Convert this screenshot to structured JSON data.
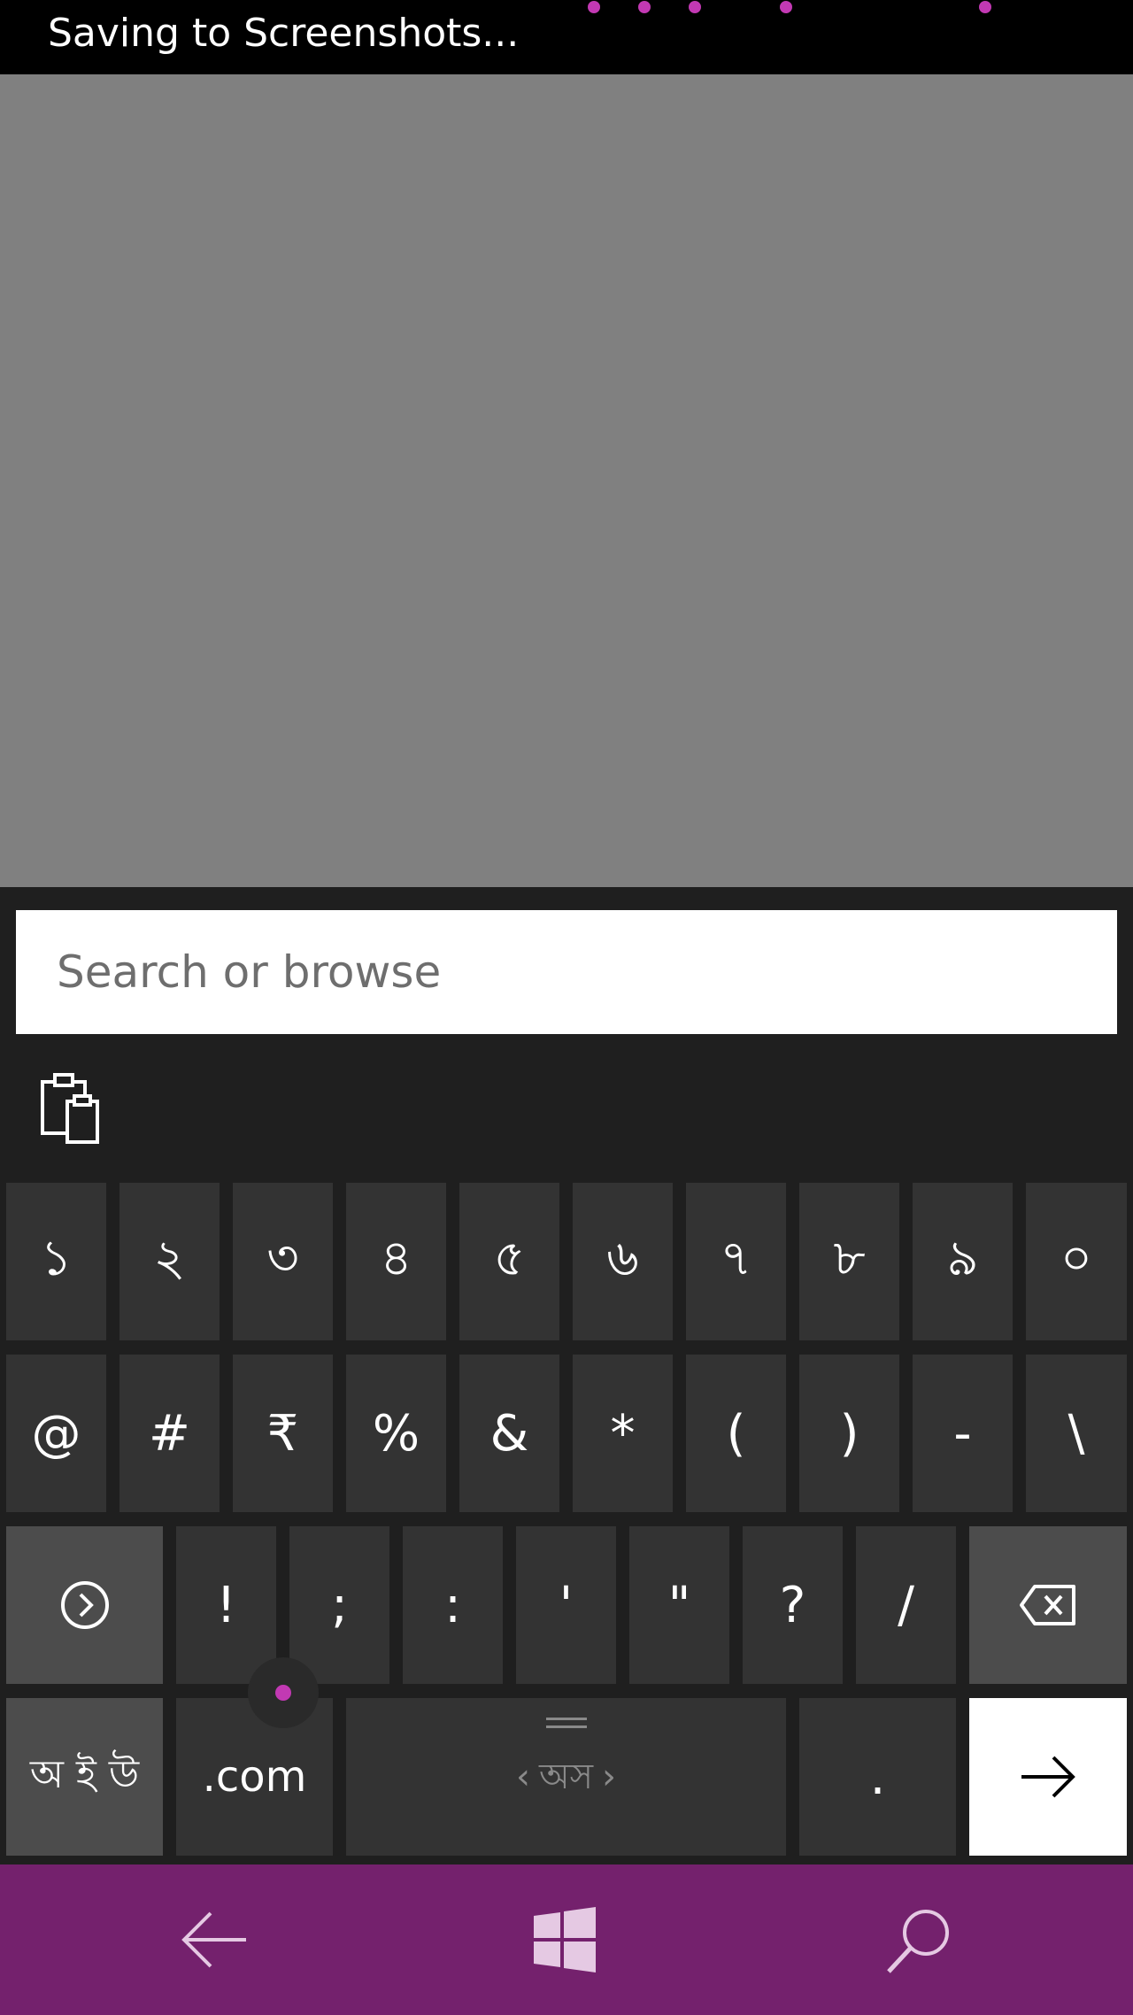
{
  "status_bar": {
    "text": "Saving to Screenshots...",
    "accent_color": "#c239b3"
  },
  "search": {
    "placeholder": "Search or browse"
  },
  "keyboard": {
    "suggestion_bar": {
      "clipboard_icon": "clipboard-icon"
    },
    "row1": [
      "১",
      "২",
      "৩",
      "৪",
      "৫",
      "৬",
      "৭",
      "৮",
      "৯",
      "০"
    ],
    "row2": [
      "@",
      "#",
      "₹",
      "%",
      "&",
      "*",
      "(",
      ")",
      "-",
      "\\"
    ],
    "row3": {
      "emoji_icon": "emoji-icon",
      "keys": [
        "!",
        ";",
        ":",
        "'",
        "\"",
        "?",
        "/"
      ],
      "backspace_icon": "backspace-icon"
    },
    "row4": {
      "lang_switch": "অ ই উ",
      "dotcom": ".com",
      "space_label": "অস",
      "period": ".",
      "enter_icon": "arrow-right-icon"
    }
  },
  "nav_bar": {
    "color": "#74216d",
    "back_icon": "back-arrow-icon",
    "home_icon": "windows-logo-icon",
    "search_icon": "search-icon"
  }
}
